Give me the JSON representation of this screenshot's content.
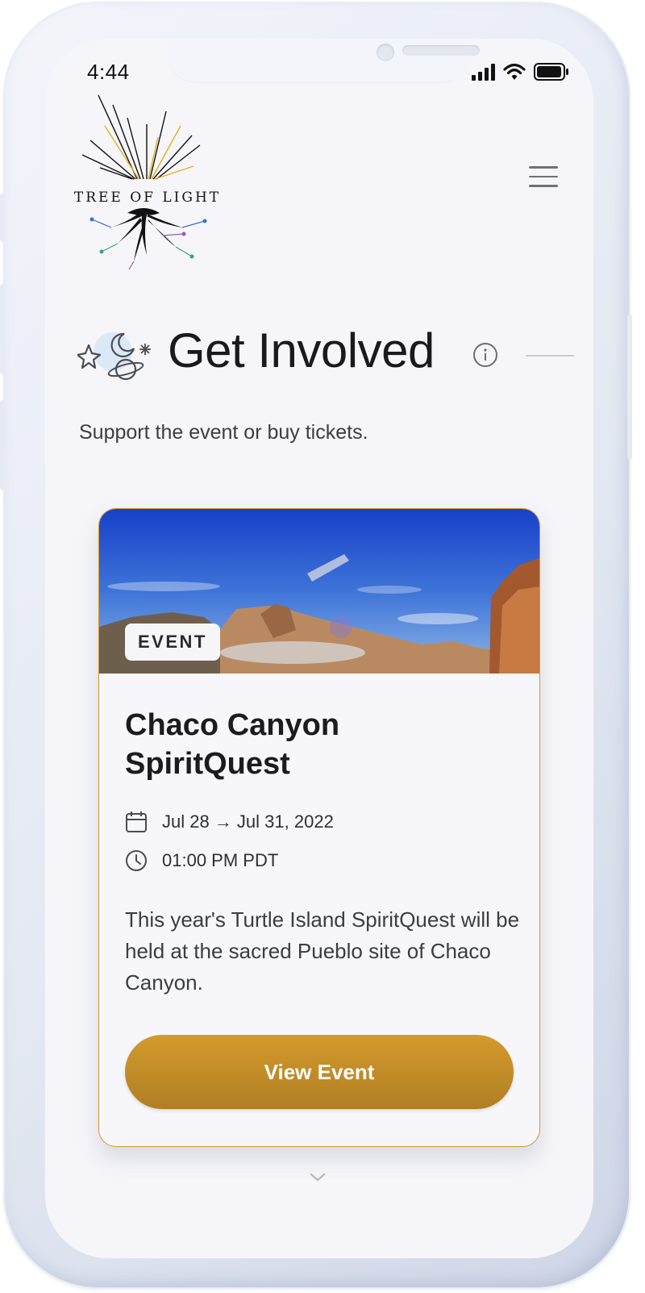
{
  "status_bar": {
    "time": "4:44"
  },
  "header": {
    "logo_text": "TREE OF LIGHT"
  },
  "section": {
    "title": "Get Involved",
    "subtitle": "Support the event or buy tickets."
  },
  "event_card": {
    "badge": "EVENT",
    "title": "Chaco Canyon SpiritQuest",
    "date": "Jul 28 → Jul 31, 2022",
    "time": "01:00 PM PDT",
    "description": "This year's Turtle Island SpiritQuest will be held at the sacred Pueblo site of Chaco Canyon.",
    "button_label": "View Event"
  },
  "colors": {
    "accent": "#d39a2b",
    "button_gradient_top": "#d49a2b",
    "button_gradient_bottom": "#b07f24",
    "background": "#f6f6fa"
  },
  "icons": [
    "signal-icon",
    "wifi-icon",
    "battery-icon",
    "menu-icon",
    "celestial-icon",
    "info-icon",
    "calendar-icon",
    "clock-icon",
    "chevron-down-icon"
  ]
}
